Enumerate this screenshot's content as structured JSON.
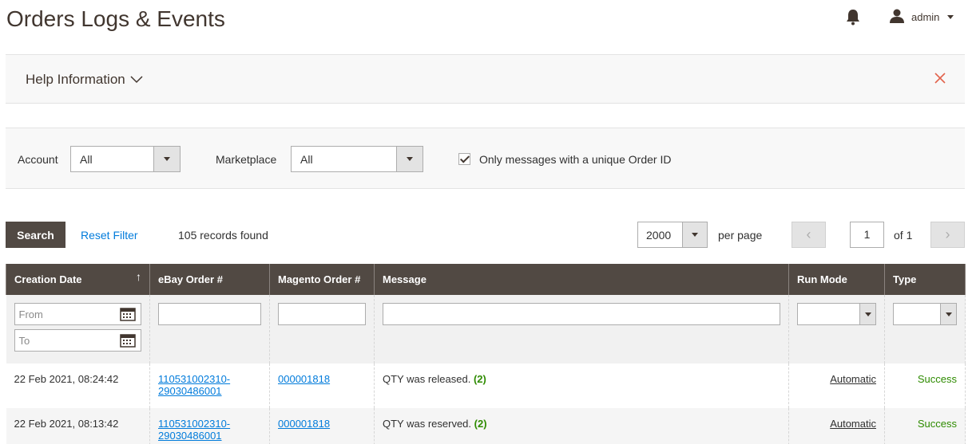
{
  "header": {
    "title": "Orders Logs & Events",
    "user_name": "admin"
  },
  "help": {
    "title": "Help Information"
  },
  "filters": {
    "account_label": "Account",
    "account_value": "All",
    "marketplace_label": "Marketplace",
    "marketplace_value": "All",
    "unique_label": "Only messages with a unique Order ID",
    "unique_checked": true
  },
  "toolbar": {
    "search_label": "Search",
    "reset_label": "Reset Filter",
    "records": "105 records found",
    "per_page_value": "2000",
    "per_page_label": "per page",
    "prev_glyph": "‹",
    "next_glyph": "›",
    "page_value": "1",
    "page_of": "of 1"
  },
  "grid": {
    "columns": [
      "Creation Date",
      "eBay Order #",
      "Magento Order #",
      "Message",
      "Run Mode",
      "Type"
    ],
    "sort_glyph": "↑",
    "date_from_placeholder": "From",
    "date_to_placeholder": "To",
    "rows": [
      {
        "date": "22 Feb 2021, 08:24:42",
        "ebay_line1": "110531002310-",
        "ebay_line2": "29030486001",
        "magento": "000001818",
        "message": "QTY was released.",
        "count": "(2)",
        "run_mode": "Automatic",
        "type": "Success"
      },
      {
        "date": "22 Feb 2021, 08:13:42",
        "ebay_line1": "110531002310-",
        "ebay_line2": "29030486001",
        "magento": "000001818",
        "message": "QTY was reserved.",
        "count": "(2)",
        "run_mode": "Automatic",
        "type": "Success"
      }
    ]
  },
  "colors": {
    "header_bg": "#514943",
    "link": "#007bdb",
    "success": "#2e8b00",
    "close_icon": "#e2644d"
  }
}
